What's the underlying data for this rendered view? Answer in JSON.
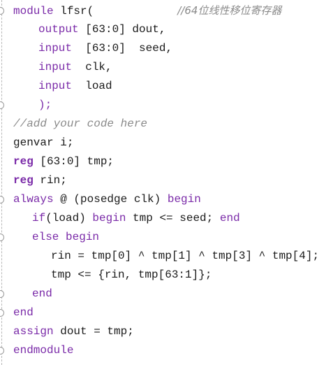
{
  "editor": {
    "lines": {
      "l0": {
        "kw": "module",
        "name": " lfsr(",
        "comment": "//64位线性移位寄存器"
      },
      "l1": {
        "kw": "output",
        "rest": " [63:0] dout,"
      },
      "l2": {
        "kw": "input",
        "rest": "  [63:0]  seed,"
      },
      "l3": {
        "kw": "input",
        "rest": "  clk,"
      },
      "l4": {
        "kw": "input",
        "rest": "  load"
      },
      "l5": {
        "rest": ");"
      },
      "l6": {
        "comment": "//add your code here"
      },
      "l7": {
        "rest": "genvar i;"
      },
      "l8": {
        "kw": "reg",
        "rest": " [63:0] tmp;"
      },
      "l9": {
        "kw": "reg",
        "rest": " rin;"
      },
      "l10": {
        "kw": "always",
        "rest": " @ (posedge clk) ",
        "kw2": "begin"
      },
      "l11": {
        "kw": "if",
        "rest1": "(load) ",
        "kw2": "begin",
        "rest2": " tmp <= seed; ",
        "kw3": "end"
      },
      "l12": {
        "kw": "else",
        "rest": " ",
        "kw2": "begin"
      },
      "l13": {
        "rest": "rin = tmp[0] ^ tmp[1] ^ tmp[3] ^ tmp[4];"
      },
      "l14": {
        "rest": "tmp <= {rin, tmp[63:1]};"
      },
      "l15": {
        "kw": "end"
      },
      "l16": {
        "kw": "end"
      },
      "l17": {
        "kw": "assign",
        "rest": " dout = tmp;"
      },
      "l18": {
        "kw": "endmodule"
      }
    }
  }
}
